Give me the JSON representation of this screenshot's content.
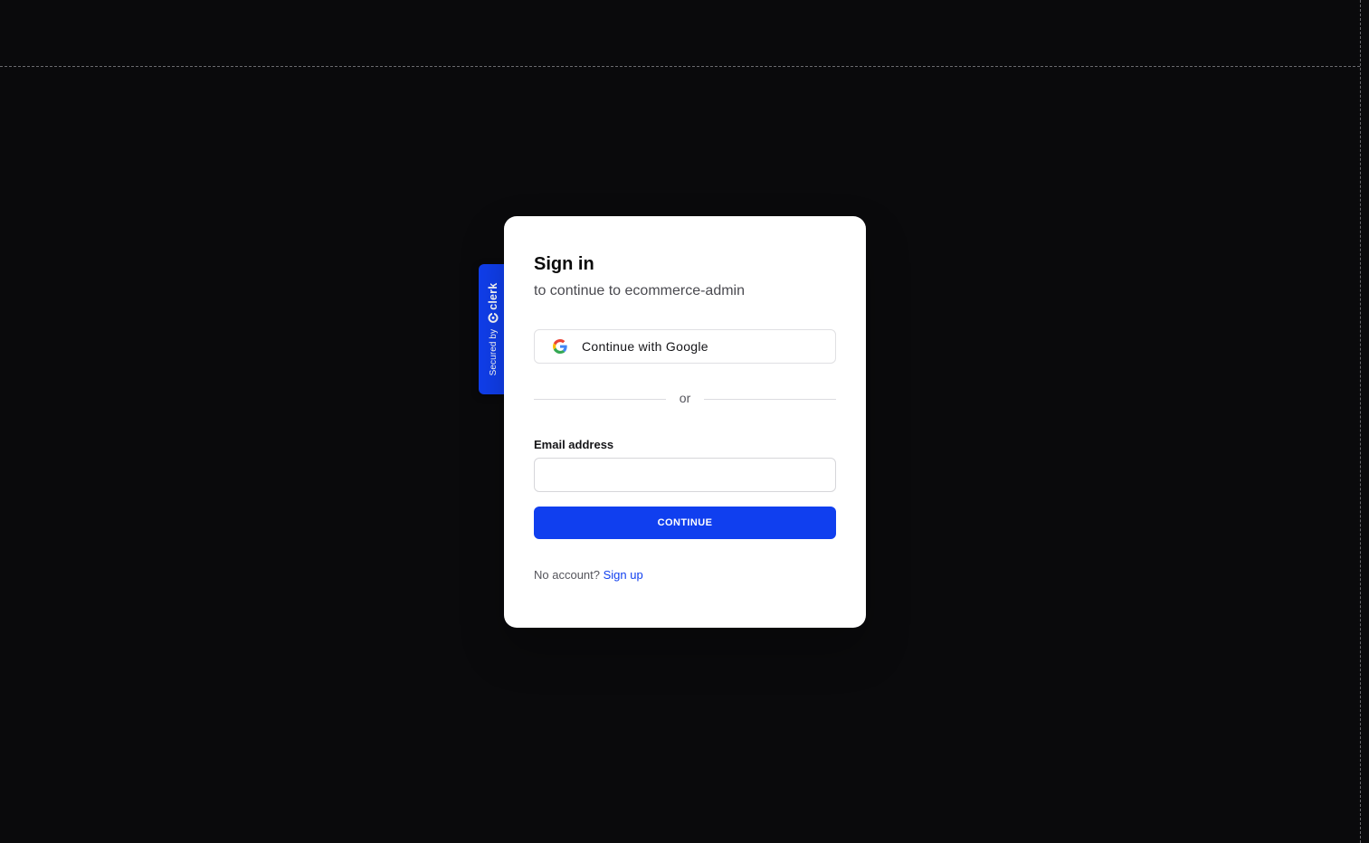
{
  "badge": {
    "secured_label": "Secured by",
    "brand": "clerk",
    "logo_icon": "clerk-logo-icon",
    "color": "#103fef"
  },
  "signin": {
    "title": "Sign in",
    "subtitle": "to continue to ecommerce-admin",
    "google_button_label": "Continue with Google",
    "google_icon": "google-icon",
    "divider_text": "or",
    "email_label": "Email address",
    "email_value": "",
    "email_placeholder": "",
    "continue_label": "CONTINUE",
    "no_account_text": "No account?",
    "signup_link": "Sign up"
  },
  "colors": {
    "background": "#0a0a0c",
    "card": "#ffffff",
    "accent": "#103fef"
  }
}
